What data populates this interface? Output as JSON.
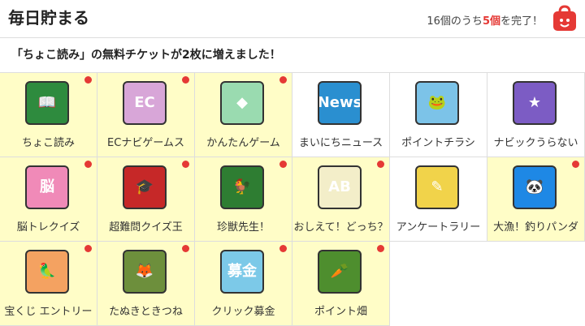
{
  "header": {
    "title": "毎日貯まる",
    "progress_prefix": "16個のうち",
    "progress_count": "5個",
    "progress_suffix": "を完了！"
  },
  "notice": "「ちょこ読み」の無料チケットが2枚に増えました！",
  "tiles": [
    {
      "label": "ちょこ読み",
      "new": true,
      "icon": "book-icon",
      "color": "#2e8b3e",
      "symbol": "📖"
    },
    {
      "label": "ECナビゲームス",
      "new": true,
      "icon": "ecnavi-games-icon",
      "color": "#d8a6d8",
      "symbol": "EC"
    },
    {
      "label": "かんたんゲーム",
      "new": true,
      "icon": "cube-icon",
      "color": "#9adbb0",
      "symbol": "◆"
    },
    {
      "label": "まいにちニュース",
      "new": false,
      "icon": "news-icon",
      "color": "#2a8fd0",
      "symbol": "News"
    },
    {
      "label": "ポイントチラシ",
      "new": false,
      "icon": "frog-icon",
      "color": "#7cc3e8",
      "symbol": "🐸"
    },
    {
      "label": "ナビックうらない",
      "new": false,
      "icon": "fortune-icon",
      "color": "#7c5cc4",
      "symbol": "★"
    },
    {
      "label": "脳トレクイズ",
      "new": true,
      "icon": "brain-quiz-icon",
      "color": "#f08ab8",
      "symbol": "脳"
    },
    {
      "label": "超難問クイズ王",
      "new": true,
      "icon": "graduation-cap-icon",
      "color": "#c62828",
      "symbol": "🎓"
    },
    {
      "label": "珍獣先生！",
      "new": true,
      "icon": "rooster-icon",
      "color": "#2e7d32",
      "symbol": "🐓"
    },
    {
      "label": "おしえて！どっち？",
      "new": true,
      "icon": "balloons-icon",
      "color": "#f3eec9",
      "symbol": "AB"
    },
    {
      "label": "アンケートラリー",
      "new": false,
      "icon": "survey-rally-icon",
      "color": "#f1d34a",
      "symbol": "✎"
    },
    {
      "label": "大漁！釣りパンダ",
      "new": true,
      "icon": "panda-icon",
      "color": "#1e88e5",
      "symbol": "🐼"
    },
    {
      "label": "宝くじ エントリー",
      "new": true,
      "icon": "bird-icon",
      "color": "#f4a261",
      "symbol": "🦜"
    },
    {
      "label": "たぬきときつね",
      "new": true,
      "icon": "tanuki-fox-icon",
      "color": "#6d8f3c",
      "symbol": "🦊"
    },
    {
      "label": "クリック募金",
      "new": true,
      "icon": "donation-icon",
      "color": "#7cc9e8",
      "symbol": "募金"
    },
    {
      "label": "ポイント畑",
      "new": true,
      "icon": "carrot-icon",
      "color": "#4e8e2e",
      "symbol": "🥕"
    }
  ]
}
